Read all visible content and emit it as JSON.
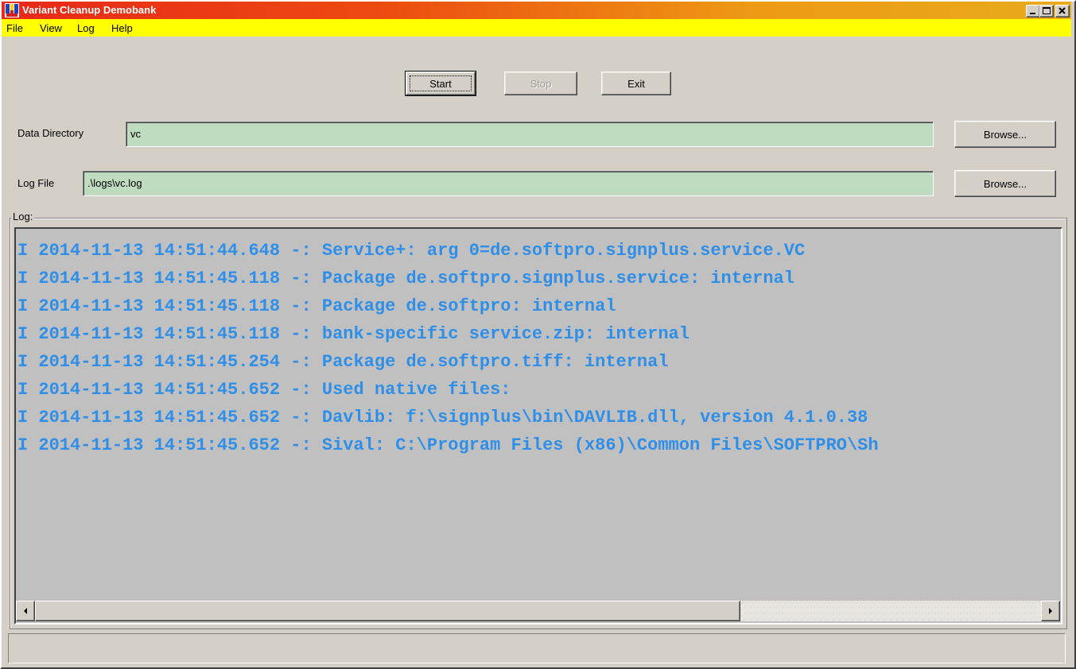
{
  "window": {
    "title": "Variant Cleanup Demobank",
    "titlebar_gradient": [
      "#e8281a",
      "#e8ab1c"
    ],
    "controls": [
      "minimize-icon",
      "maximize-icon",
      "close-icon"
    ]
  },
  "menubar": {
    "background": "#ffff00",
    "items": [
      {
        "label": "File"
      },
      {
        "label": "View"
      },
      {
        "label": "Log"
      },
      {
        "label": "Help"
      }
    ]
  },
  "toolbar": {
    "start_label": "Start",
    "stop_label": "Stop",
    "exit_label": "Exit"
  },
  "form": {
    "data_directory": {
      "label": "Data Directory",
      "value": "vc",
      "browse_label": "Browse..."
    },
    "log_file": {
      "label": "Log File",
      "value": ".\\logs\\vc.log",
      "browse_label": "Browse..."
    },
    "field_color": "#c0dcc0"
  },
  "log": {
    "group_label": "Log:",
    "text_color": "#2f8fe8",
    "lines": [
      "I 2014-11-13 14:51:44.648 -: Service+: arg 0=de.softpro.signplus.service.VC",
      "I 2014-11-13 14:51:45.118 -: Package de.softpro.signplus.service: internal",
      "I 2014-11-13 14:51:45.118 -: Package de.softpro: internal",
      "I 2014-11-13 14:51:45.118 -: bank-specific service.zip: internal",
      "I 2014-11-13 14:51:45.254 -: Package de.softpro.tiff: internal",
      "I 2014-11-13 14:51:45.652 -: Used native files:",
      "I 2014-11-13 14:51:45.652 -: Davlib: f:\\signplus\\bin\\DAVLIB.dll, version 4.1.0.38",
      "I 2014-11-13 14:51:45.652 -: Sival: C:\\Program Files (x86)\\Common Files\\SOFTPRO\\Sh"
    ]
  },
  "statusbar": {
    "text": ""
  }
}
